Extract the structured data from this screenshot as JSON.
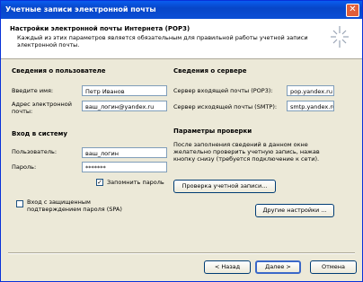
{
  "window": {
    "title": "Учетные записи электронной почты"
  },
  "header": {
    "title": "Настройки электронной почты Интернета (POP3)",
    "description": "Каждый из этих параметров является обязательным для правильной работы учетной записи электронной почты."
  },
  "user_info": {
    "title": "Сведения о пользователе",
    "name_label": "Введите имя:",
    "name_value": "Петр Иванов",
    "email_label": "Адрес электронной почты:",
    "email_value": "ваш_логин@yandex.ru"
  },
  "login": {
    "title": "Вход в систему",
    "user_label": "Пользователь:",
    "user_value": "ваш_логин",
    "password_label": "Пароль:",
    "password_value": "*******",
    "remember_label": "Запомнить пароль",
    "remember_checked": true,
    "spa_label": "Вход с защищенным подтверждением пароля (SPA)",
    "spa_checked": false
  },
  "server_info": {
    "title": "Сведения о сервере",
    "incoming_label": "Сервер входящей почты (POP3):",
    "incoming_value": "pop.yandex.ru",
    "outgoing_label": "Сервер исходящей почты (SMTP):",
    "outgoing_value": "smtp.yandex.ru"
  },
  "check": {
    "title": "Параметры проверки",
    "description": "После заполнения сведений в данном окне желательно проверить учетную запись, нажав кнопку снизу (требуется подключение к сети).",
    "check_button": "Проверка учетной записи...",
    "more_button": "Другие настройки ..."
  },
  "footer": {
    "back_button": "< Назад",
    "next_button": "Далее >",
    "cancel_button": "Отмена"
  },
  "colors": {
    "titlebar": "#0a5df0",
    "face": "#ece9d8",
    "close": "#e05f3a"
  },
  "icons": {
    "close": "close-icon",
    "header": "sparkle-icon"
  }
}
